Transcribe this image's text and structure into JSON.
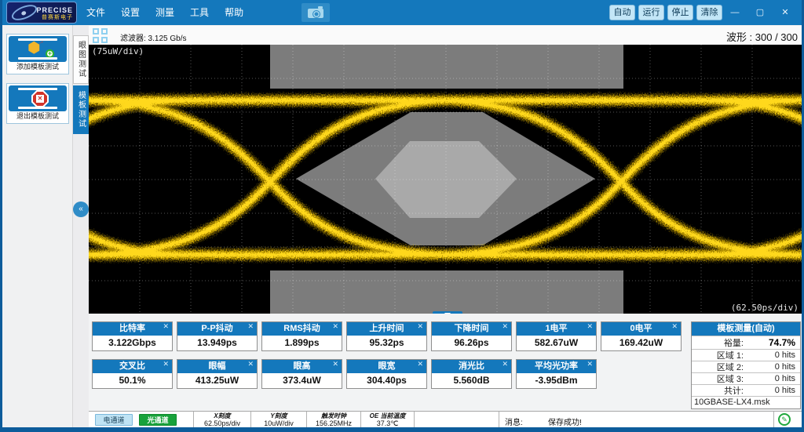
{
  "titlebar": {
    "brand": "PRECISE",
    "brand_sub": "普赛斯电子",
    "menus": [
      "文件",
      "设置",
      "测量",
      "工具",
      "帮助"
    ],
    "buttons": [
      "自动",
      "运行",
      "停止",
      "清除"
    ],
    "window_controls": {
      "minimize": "—",
      "maximize": "▢",
      "close": "✕"
    }
  },
  "sidebar": {
    "buttons": [
      {
        "label": "添加模板测试"
      },
      {
        "label": "退出模板测试"
      }
    ],
    "glyphs": {
      "hex": "⬢",
      "plus": "+",
      "arrow": "→",
      "cross": "✕"
    }
  },
  "tabs": [
    {
      "label": "眼图测试"
    },
    {
      "label": "模板测试"
    }
  ],
  "collapse_glyph": "«",
  "topbar": {
    "filter_label": "滤波器: 3.125 Gb/s",
    "waveform_label": "波形 : 300 / 300"
  },
  "plot": {
    "y_scale_label": "(75uW/div)",
    "x_scale_label": "(62.50ps/div)",
    "colors": {
      "background": "#000000",
      "grid": "#ffffff",
      "trace": "#f7c800",
      "mask": "#7c7c7c",
      "mask_inner": "#a9a9a9"
    }
  },
  "measurements": {
    "close_glyph": "✕",
    "row1": [
      {
        "label": "比特率",
        "value": "3.122Gbps"
      },
      {
        "label": "P-P抖动",
        "value": "13.949ps"
      },
      {
        "label": "RMS抖动",
        "value": "1.899ps"
      },
      {
        "label": "上升时间",
        "value": "95.32ps"
      },
      {
        "label": "下降时间",
        "value": "96.26ps"
      },
      {
        "label": "1电平",
        "value": "582.67uW"
      },
      {
        "label": "0电平",
        "value": "169.42uW"
      }
    ],
    "row2": [
      {
        "label": "交叉比",
        "value": "50.1%"
      },
      {
        "label": "眼幅",
        "value": "413.25uW"
      },
      {
        "label": "眼高",
        "value": "373.4uW"
      },
      {
        "label": "眼宽",
        "value": "304.40ps"
      },
      {
        "label": "消光比",
        "value": "5.560dB"
      },
      {
        "label": "平均光功率",
        "value": "-3.95dBm"
      }
    ]
  },
  "template_panel": {
    "title": "模板测量(自动)",
    "rows": [
      {
        "label": "裕量:",
        "value": "74.7%"
      },
      {
        "label": "区域 1:",
        "value": "0 hits"
      },
      {
        "label": "区域 2:",
        "value": "0 hits"
      },
      {
        "label": "区域 3:",
        "value": "0 hits"
      },
      {
        "label": "共计:",
        "value": "0 hits"
      }
    ],
    "mask_file": "10GBASE-LX4.msk"
  },
  "statusbar": {
    "channels": [
      {
        "label": "电通道"
      },
      {
        "label": "光通道"
      }
    ],
    "stats": [
      {
        "label": "X刻度",
        "value": "62.50ps/div"
      },
      {
        "label": "Y刻度",
        "value": "10uW/div"
      },
      {
        "label": "触发时钟",
        "value": "156.25MHz"
      },
      {
        "label": "OE 当前温度",
        "value": "37.3℃"
      }
    ],
    "message_label": "消息:",
    "message": "保存成功!",
    "status_icon_glyph": "✎"
  },
  "accent_color": "#1478bc"
}
